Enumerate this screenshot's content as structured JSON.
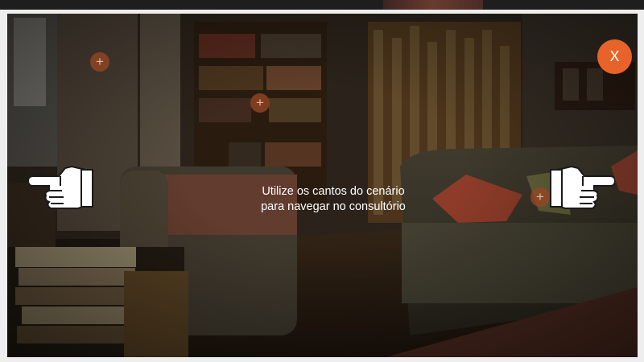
{
  "overlay": {
    "instruction_line1": "Utilize os cantos do cenário",
    "instruction_line2": "para navegar no consultório"
  },
  "close_button": {
    "label": "X",
    "color": "#e8632a"
  },
  "hotspots": {
    "symbol": "+",
    "color": "#964623"
  },
  "icons": {
    "left_hand": "pointing-hand-left-icon",
    "right_hand": "pointing-hand-right-icon",
    "close": "close-icon",
    "hotspot": "plus-icon"
  }
}
